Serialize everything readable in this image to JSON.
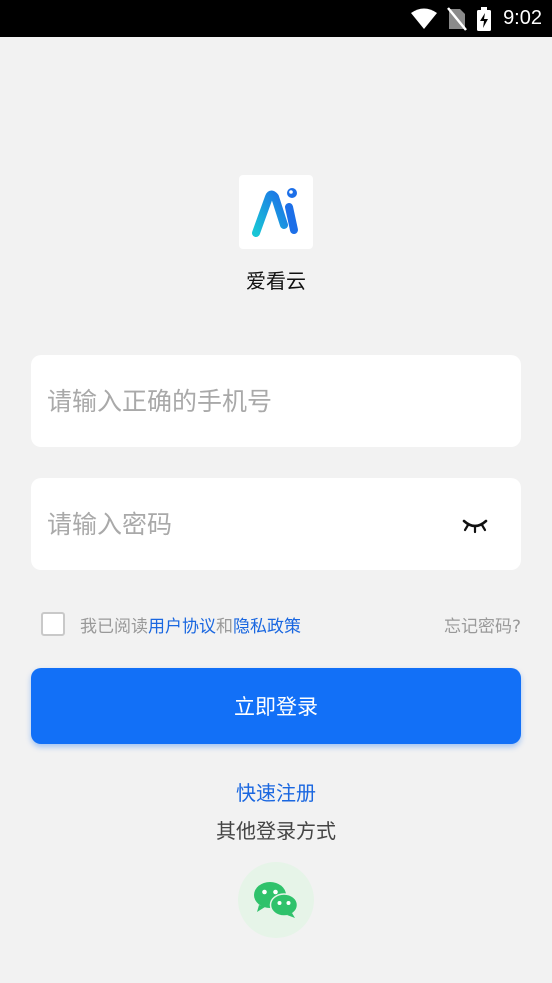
{
  "status_bar": {
    "time": "9:02",
    "icons": [
      "wifi-icon",
      "no-sim-icon",
      "battery-charging-icon"
    ]
  },
  "app": {
    "name": "爱看云",
    "logo_icon": "app-logo-ai-icon"
  },
  "form": {
    "phone_placeholder": "请输入正确的手机号",
    "password_placeholder": "请输入密码",
    "password_toggle_icon": "eye-closed-icon"
  },
  "agreement": {
    "prefix": "我已阅读",
    "user_agreement": "用户协议",
    "and": "和",
    "privacy_policy": "隐私政策",
    "checked": false
  },
  "forgot_password": "忘记密码?",
  "login_button": "立即登录",
  "register_link": "快速注册",
  "other_login_label": "其他登录方式",
  "social_login": {
    "icon": "wechat-icon"
  },
  "colors": {
    "primary": "#1270f7",
    "link": "#1a67e0",
    "background": "#f2f2f2",
    "wechat_green": "#2fc26b"
  }
}
